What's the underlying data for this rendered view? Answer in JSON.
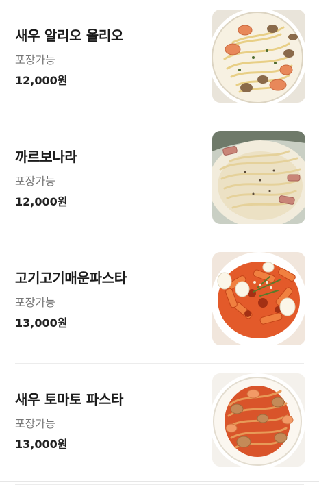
{
  "menu": {
    "items": [
      {
        "name": "새우 알리오 올리오",
        "takeout": "포장가능",
        "price": "12,000원",
        "image": "garlic-shrimp-pasta-photo"
      },
      {
        "name": "까르보나라",
        "takeout": "포장가능",
        "price": "12,000원",
        "image": "carbonara-photo"
      },
      {
        "name": "고기고기매운파스타",
        "takeout": "포장가능",
        "price": "13,000원",
        "image": "spicy-meat-penne-photo"
      },
      {
        "name": "새우 토마토 파스타",
        "takeout": "포장가능",
        "price": "13,000원",
        "image": "shrimp-tomato-pasta-photo"
      }
    ]
  },
  "colors": {
    "name_text": "#1c1c1c",
    "takeout_text": "#777777",
    "divider": "#ececec"
  }
}
